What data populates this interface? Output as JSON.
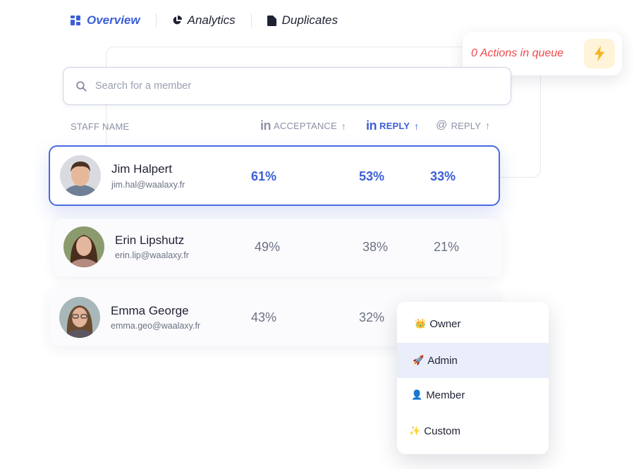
{
  "tabs": [
    {
      "label": "Overview",
      "icon": "grid-icon",
      "active": true
    },
    {
      "label": "Analytics",
      "icon": "pie-chart-icon",
      "active": false
    },
    {
      "label": "Duplicates",
      "icon": "document-icon",
      "active": false
    }
  ],
  "queue": {
    "label": "0 Actions in queue",
    "icon": "lightning-icon",
    "icon_color": "#f5b324",
    "text_color": "#f0484a"
  },
  "search": {
    "placeholder": "Search for a member"
  },
  "columns": {
    "staff_name": "STAFF NAME",
    "acceptance": {
      "prefix": "in",
      "label": "ACCEPTANCE",
      "arrow": "↑"
    },
    "reply_linkedin": {
      "prefix": "in",
      "label": "REPLY",
      "arrow": "↑"
    },
    "reply_email": {
      "prefix": "@",
      "label": "REPLY",
      "arrow": "↑"
    }
  },
  "members": [
    {
      "name": "Jim Halpert",
      "email": "jim.hal@waalaxy.fr",
      "acceptance": "61%",
      "reply_linkedin": "53%",
      "reply_email": "33%",
      "selected": true
    },
    {
      "name": "Erin Lipshutz",
      "email": "erin.lip@waalaxy.fr",
      "acceptance": "49%",
      "reply_linkedin": "38%",
      "reply_email": "21%",
      "selected": false
    },
    {
      "name": "Emma George",
      "email": "emma.geo@waalaxy.fr",
      "acceptance": "43%",
      "reply_linkedin": "32%",
      "reply_email": "",
      "selected": false
    }
  ],
  "roles": [
    {
      "emoji": "👑",
      "label": "Owner"
    },
    {
      "emoji": "🚀",
      "label": "Admin",
      "highlighted": true
    },
    {
      "emoji": "👤",
      "label": "Member"
    },
    {
      "emoji": "✨",
      "label": "Custom"
    }
  ],
  "colors": {
    "accent": "#3c5ed8",
    "danger": "#f0484a",
    "highlight": "#eaedfa"
  }
}
